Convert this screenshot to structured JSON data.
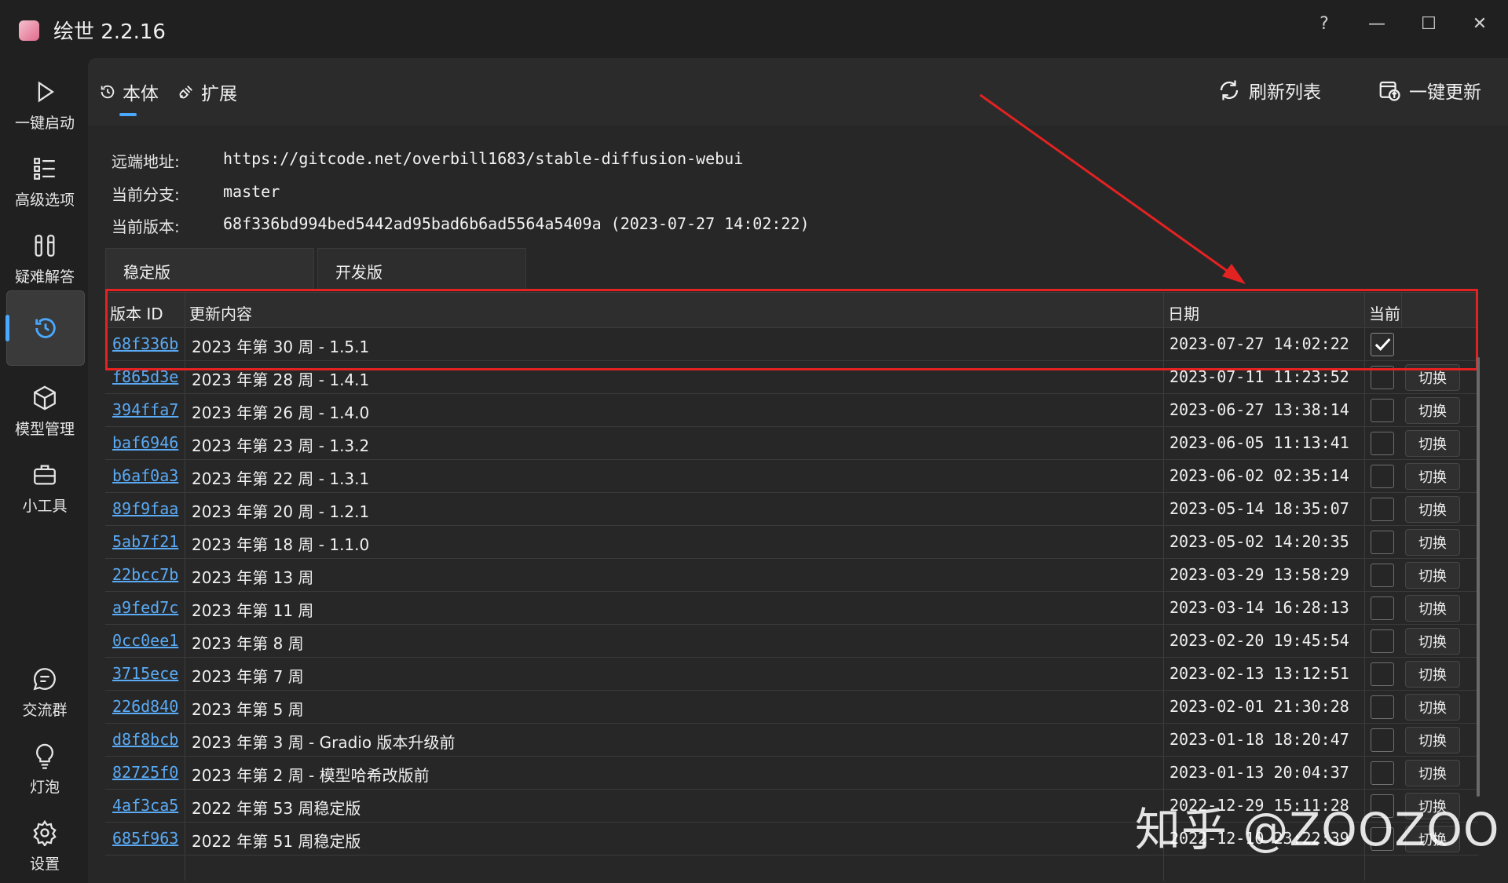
{
  "app": {
    "title": "绘世 2.2.16"
  },
  "window_controls": {
    "help": "?",
    "minimize": "—",
    "maximize": "☐",
    "close": "✕"
  },
  "sidebar": {
    "items": [
      {
        "label": "一键启动",
        "icon": "play-icon"
      },
      {
        "label": "高级选项",
        "icon": "list-icon"
      },
      {
        "label": "疑难解答",
        "icon": "tools-icon"
      },
      {
        "label": "",
        "icon": "history-icon",
        "active": true
      },
      {
        "label": "模型管理",
        "icon": "cube-icon"
      },
      {
        "label": "小工具",
        "icon": "toolbox-icon"
      }
    ],
    "bottom_items": [
      {
        "label": "交流群",
        "icon": "chat-icon"
      },
      {
        "label": "灯泡",
        "icon": "bulb-icon"
      },
      {
        "label": "设置",
        "icon": "gear-icon"
      }
    ]
  },
  "header": {
    "tabs": [
      {
        "label": "本体",
        "icon": "history-icon",
        "active": true
      },
      {
        "label": "扩展",
        "icon": "plug-icon"
      }
    ],
    "refresh_label": "刷新列表",
    "update_label": "一键更新"
  },
  "repo": {
    "remote_label": "远端地址:",
    "remote_value": "https://gitcode.net/overbill1683/stable-diffusion-webui",
    "branch_label": "当前分支:",
    "branch_value": "master",
    "version_label": "当前版本:",
    "version_value": "68f336bd994bed5442ad95bad6b6ad5564a5409a (2023-07-27 14:02:22)"
  },
  "subtabs": [
    "稳定版",
    "开发版"
  ],
  "table": {
    "headers": {
      "id": "版本 ID",
      "content": "更新内容",
      "date": "日期",
      "current": "当前"
    },
    "switch_label": "切换",
    "rows": [
      {
        "id": "68f336b",
        "content": "2023 年第 30 周 - 1.5.1",
        "date": "2023-07-27 14:02:22",
        "current": true
      },
      {
        "id": "f865d3e",
        "content": "2023 年第 28 周 - 1.4.1",
        "date": "2023-07-11 11:23:52",
        "current": false
      },
      {
        "id": "394ffa7",
        "content": "2023 年第 26 周 - 1.4.0",
        "date": "2023-06-27 13:38:14",
        "current": false
      },
      {
        "id": "baf6946",
        "content": "2023 年第 23 周 - 1.3.2",
        "date": "2023-06-05 11:13:41",
        "current": false
      },
      {
        "id": "b6af0a3",
        "content": "2023 年第 22 周 - 1.3.1",
        "date": "2023-06-02 02:35:14",
        "current": false
      },
      {
        "id": "89f9faa",
        "content": "2023 年第 20 周 - 1.2.1",
        "date": "2023-05-14 18:35:07",
        "current": false
      },
      {
        "id": "5ab7f21",
        "content": "2023 年第 18 周 - 1.1.0",
        "date": "2023-05-02 14:20:35",
        "current": false
      },
      {
        "id": "22bcc7b",
        "content": "2023 年第 13 周",
        "date": "2023-03-29 13:58:29",
        "current": false
      },
      {
        "id": "a9fed7c",
        "content": "2023 年第 11 周",
        "date": "2023-03-14 16:28:13",
        "current": false
      },
      {
        "id": "0cc0ee1",
        "content": "2023 年第 8 周",
        "date": "2023-02-20 19:45:54",
        "current": false
      },
      {
        "id": "3715ece",
        "content": "2023 年第 7 周",
        "date": "2023-02-13 13:12:51",
        "current": false
      },
      {
        "id": "226d840",
        "content": "2023 年第 5 周",
        "date": "2023-02-01 21:30:28",
        "current": false
      },
      {
        "id": "d8f8bcb",
        "content": "2023 年第 3 周 - Gradio 版本升级前",
        "date": "2023-01-18 18:20:47",
        "current": false
      },
      {
        "id": "82725f0",
        "content": "2023 年第 2 周 - 模型哈希改版前",
        "date": "2023-01-13 20:04:37",
        "current": false
      },
      {
        "id": "4af3ca5",
        "content": "2022 年第 53 周稳定版",
        "date": "2022-12-29 15:11:28",
        "current": false
      },
      {
        "id": "685f963",
        "content": "2022 年第 51 周稳定版",
        "date": "2022-12-10 23:22:39",
        "current": false
      }
    ]
  },
  "watermark": "知乎 @ZOOZOO",
  "colors": {
    "accent": "#4aa8ff",
    "link": "#5aaaf5",
    "highlight": "#e32222",
    "background": "#202020"
  }
}
